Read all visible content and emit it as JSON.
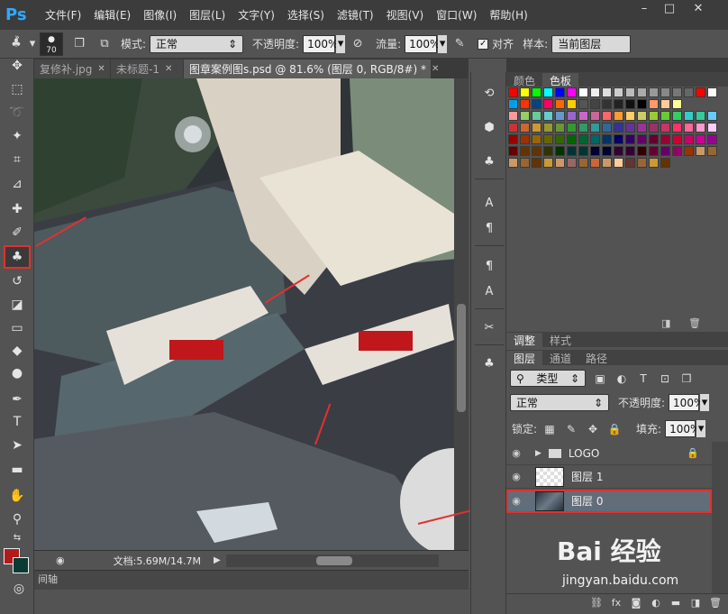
{
  "app": {
    "logo": "Ps",
    "menu": [
      "文件(F)",
      "编辑(E)",
      "图像(I)",
      "图层(L)",
      "文字(Y)",
      "选择(S)",
      "滤镜(T)",
      "视图(V)",
      "窗口(W)",
      "帮助(H)"
    ],
    "window_controls": [
      "–",
      "□",
      "✕"
    ]
  },
  "options": {
    "brush_size": "70",
    "mode_label": "模式:",
    "mode_value": "正常",
    "opacity_label": "不透明度:",
    "opacity_value": "100%",
    "flow_label": "流量:",
    "flow_value": "100%",
    "align_label": "对齐",
    "sample_label": "样本:",
    "sample_value": "当前图层"
  },
  "tabs": [
    {
      "label": "复修补.jpg",
      "active": false
    },
    {
      "label": "未标题-1",
      "active": false
    },
    {
      "label": "图章案例图s.psd @ 81.6% (图层 0, RGB/8#) *",
      "active": true
    }
  ],
  "status": {
    "doc": "文档:5.69M/14.7M"
  },
  "timeline": {
    "label": "间轴"
  },
  "swatch_panel": {
    "tabs": [
      {
        "label": "颜色",
        "active": false
      },
      {
        "label": "色板",
        "active": true
      }
    ]
  },
  "adjust_panel": {
    "tabs": [
      {
        "label": "调整",
        "active": true
      },
      {
        "label": "样式",
        "active": false
      }
    ]
  },
  "layers_panel": {
    "tabs": [
      {
        "label": "图层",
        "active": true
      },
      {
        "label": "通道",
        "active": false
      },
      {
        "label": "路径",
        "active": false
      }
    ],
    "filter_value": "类型",
    "blend_value": "正常",
    "opacity_label": "不透明度:",
    "opacity_value": "100%",
    "lock_label": "锁定:",
    "fill_label": "填充:",
    "fill_value": "100%",
    "layers": [
      {
        "name": "LOGO",
        "type": "group"
      },
      {
        "name": "图层 1",
        "type": "layer"
      },
      {
        "name": "图层 0",
        "type": "photo",
        "selected": true
      }
    ]
  },
  "watermark": {
    "brand": "Bai 经验",
    "url": "jingyan.baidu.com"
  },
  "colors": {
    "accent_red": "#e3302e",
    "foreground_swatch": "#b01c1c",
    "background_swatch": "#0b3a35"
  }
}
